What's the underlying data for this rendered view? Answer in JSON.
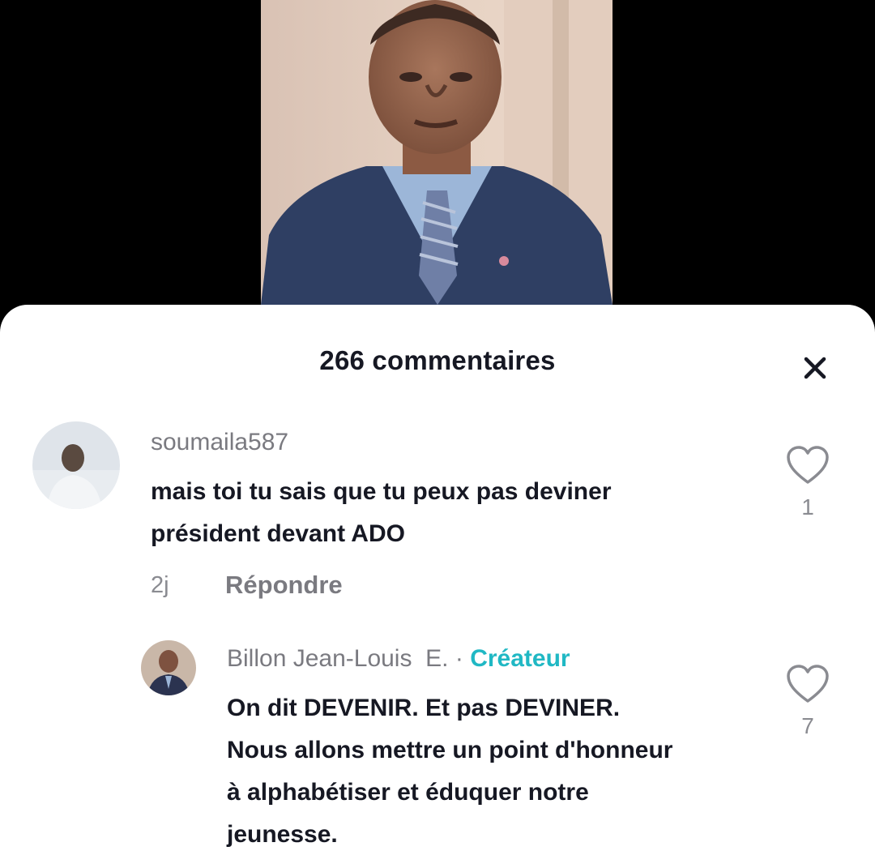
{
  "comments_panel": {
    "title": "266 commentaires",
    "close_icon": "close-icon"
  },
  "comments": [
    {
      "username": "soumaila587",
      "text_lines": [
        "mais toi tu sais que tu peux pas deviner",
        "président devant ADO"
      ],
      "time": "2j",
      "reply_label": "Répondre",
      "likes": "1"
    }
  ],
  "replies": [
    {
      "username": "Billon Jean-Louis  E.",
      "separator": "·",
      "badge": "Créateur",
      "text_lines": [
        "On dit DEVENIR. Et pas DEVINER.",
        "Nous allons mettre un point d'honneur",
        "à alphabétiser et éduquer notre",
        "jeunesse."
      ],
      "likes": "7"
    }
  ],
  "colors": {
    "creator_badge": "#20b8c4",
    "username": "#7a7a80",
    "text": "#161823",
    "background_top": "#000000"
  }
}
